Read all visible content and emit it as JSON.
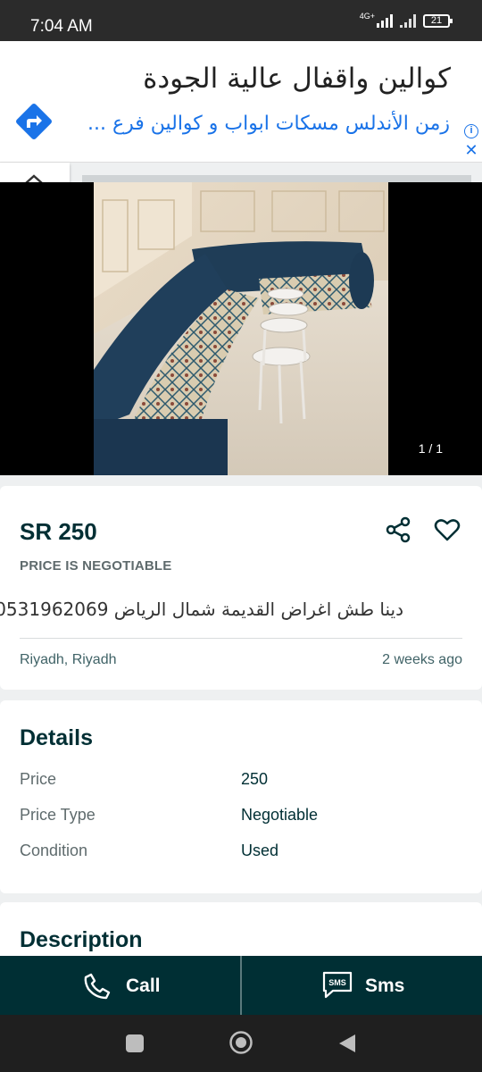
{
  "status_bar": {
    "time": "7:04 AM",
    "network": "4G+",
    "battery": "21"
  },
  "ad_banner": {
    "title": "كوالين واقفال عالية الجودة",
    "subtitle": "زمن الأندلس مسكات ابواب و كوالين فرع ...",
    "icons": [
      "directions-icon",
      "info-icon",
      "close-icon"
    ]
  },
  "gallery": {
    "counter": "1 / 1"
  },
  "listing": {
    "price": "SR 250",
    "negotiable_label": "PRICE IS NEGOTIABLE",
    "title": "دينا طش اغراض القديمة شمال الرياض 0531962069",
    "location": "Riyadh, Riyadh",
    "posted": "2 weeks ago"
  },
  "details": {
    "title": "Details",
    "rows": [
      {
        "key": "Price",
        "value": "250"
      },
      {
        "key": "Price Type",
        "value": "Negotiable"
      },
      {
        "key": "Condition",
        "value": "Used"
      }
    ]
  },
  "description": {
    "title": "Description"
  },
  "actions": {
    "call_label": "Call",
    "sms_label": "Sms",
    "sms_icon_text": "SMS"
  },
  "colors": {
    "primary": "#002f34",
    "link": "#1a73e8",
    "muted": "#5f6b6d"
  }
}
